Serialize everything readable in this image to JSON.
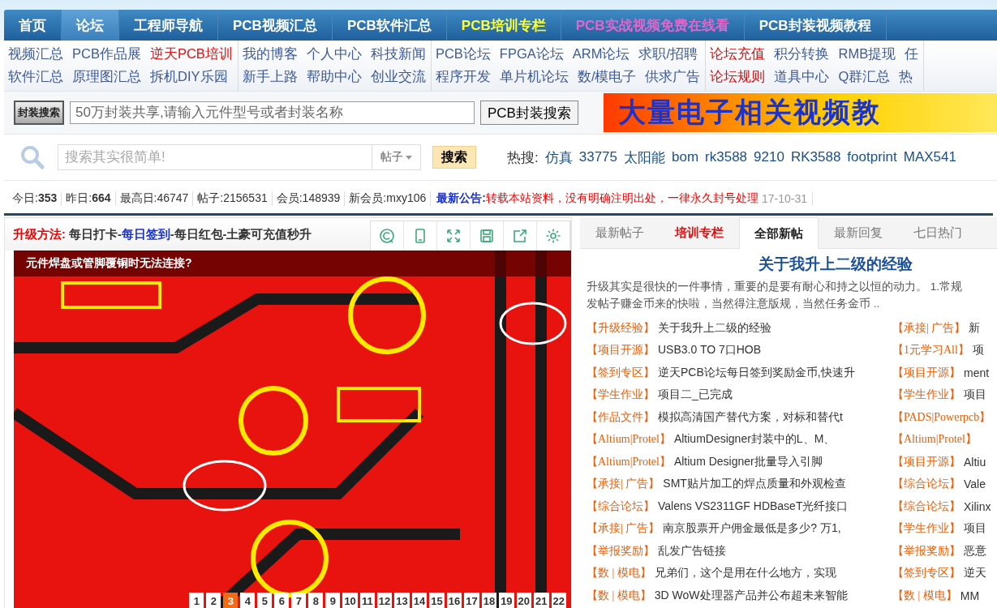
{
  "nav": {
    "items": [
      {
        "label": "首页",
        "selected": false,
        "kind": "normal"
      },
      {
        "label": "论坛",
        "selected": true,
        "kind": "normal"
      },
      {
        "label": "工程师导航",
        "selected": false,
        "kind": "normal"
      },
      {
        "label": "PCB视频汇总",
        "selected": false,
        "kind": "normal"
      },
      {
        "label": "PCB软件汇总",
        "selected": false,
        "kind": "normal"
      },
      {
        "label": "PCB培训专栏",
        "selected": false,
        "kind": "training"
      },
      {
        "label": "PCB实战视频免费在线看",
        "selected": false,
        "kind": "promo"
      },
      {
        "label": "PCB封装视频教程",
        "selected": false,
        "kind": "normal"
      }
    ]
  },
  "sub_links": [
    {
      "rows": [
        [
          {
            "label": "视频汇总",
            "color": "#3d5a99"
          },
          {
            "label": "PCB作品展",
            "color": "#3d5a99"
          },
          {
            "label": "逆天PCB培训",
            "color": "#dd1111"
          }
        ],
        [
          {
            "label": "软件汇总",
            "color": "#3d5a99"
          },
          {
            "label": "原理图汇总",
            "color": "#3d5a99"
          },
          {
            "label": "拆机DIY乐园",
            "color": "#3d5a99"
          }
        ]
      ]
    },
    {
      "rows": [
        [
          {
            "label": "我的博客",
            "color": "#3d5a99"
          },
          {
            "label": "个人中心",
            "color": "#3d5a99"
          },
          {
            "label": "科技新闻",
            "color": "#3d5a99"
          }
        ],
        [
          {
            "label": "新手上路",
            "color": "#3d5a99"
          },
          {
            "label": "帮助中心",
            "color": "#3d5a99"
          },
          {
            "label": "创业交流",
            "color": "#3d5a99"
          }
        ]
      ]
    },
    {
      "rows": [
        [
          {
            "label": "PCB论坛",
            "color": "#3d5a99"
          },
          {
            "label": "FPGA论坛",
            "color": "#3d5a99"
          },
          {
            "label": "ARM论坛",
            "color": "#3d5a99"
          },
          {
            "label": "求职/招聘",
            "color": "#3d5a99"
          }
        ],
        [
          {
            "label": "程序开发",
            "color": "#3d5a99"
          },
          {
            "label": "单片机论坛",
            "color": "#3d5a99"
          },
          {
            "label": "数/模电子",
            "color": "#3d5a99"
          },
          {
            "label": "供求广告",
            "color": "#3d5a99"
          }
        ]
      ]
    },
    {
      "rows": [
        [
          {
            "label": "论坛充值",
            "color": "#cc1111"
          },
          {
            "label": "积分转换",
            "color": "#3d5a99"
          },
          {
            "label": "RMB提现",
            "color": "#3d5a99"
          },
          {
            "label": "任",
            "color": "#3d5a99"
          }
        ],
        [
          {
            "label": "论坛规则",
            "color": "#cc1111"
          },
          {
            "label": "道具中心",
            "color": "#3d5a99"
          },
          {
            "label": "Q群汇总",
            "color": "#3d5a99"
          },
          {
            "label": "热",
            "color": "#3d5a99"
          }
        ]
      ]
    }
  ],
  "package_search": {
    "logo": "封装搜索",
    "placeholder": "50万封装共享,请输入元件型号或者封装名称",
    "button": "PCB封装搜索",
    "banner": "大量电子相关视频教"
  },
  "site_search": {
    "placeholder": "搜索其实很简单!",
    "scope": "帖子",
    "button": "搜索",
    "hot_label": "热搜:",
    "hot": [
      "仿真",
      "33775",
      "太阳能",
      "bom",
      "rk3588",
      "9210",
      "RK3588",
      "footprint",
      "MAX541"
    ]
  },
  "stats": [
    "今日:**353**",
    "昨日:**664**",
    "最高日:46747",
    "帖子:2156531",
    "会员:148939",
    "新会员:mxy106"
  ],
  "notice": {
    "label": "最新公告:",
    "text": "转载本站资料，没有明确注明出处，一律永久封号处理",
    "date": "17-10-31"
  },
  "slider": {
    "label": "升级方法:",
    "segments": [
      {
        "text": "每日打卡-",
        "kind": "plain"
      },
      {
        "text": "每日签到",
        "kind": "link"
      },
      {
        "text": "-每日红包-土豪可充值秒升",
        "kind": "plain"
      }
    ],
    "caption": "元件焊盘或管脚覆铜时无法连接?",
    "pages": [
      {
        "label": "1",
        "selected": false
      },
      {
        "label": "2",
        "selected": false
      },
      {
        "label": "3",
        "selected": true
      },
      {
        "label": "4",
        "selected": false
      },
      {
        "label": "5",
        "selected": false
      },
      {
        "label": "6",
        "selected": false
      },
      {
        "label": "7",
        "selected": false
      },
      {
        "label": "8",
        "selected": false
      },
      {
        "label": "9",
        "selected": false
      },
      {
        "label": "10",
        "selected": false
      },
      {
        "label": "11",
        "selected": false
      },
      {
        "label": "12",
        "selected": false
      },
      {
        "label": "13",
        "selected": false
      },
      {
        "label": "14",
        "selected": false
      },
      {
        "label": "15",
        "selected": false
      },
      {
        "label": "16",
        "selected": false
      },
      {
        "label": "17",
        "selected": false
      },
      {
        "label": "18",
        "selected": false
      },
      {
        "label": "19",
        "selected": false
      },
      {
        "label": "20",
        "selected": false
      },
      {
        "label": "21",
        "selected": false
      },
      {
        "label": "22",
        "selected": false
      }
    ]
  },
  "posts": {
    "tabs": [
      {
        "label": "最新帖子",
        "selected": false,
        "color": "#777777"
      },
      {
        "label": "培训专栏",
        "selected": false,
        "color": "#dd1111"
      },
      {
        "label": "全部新帖",
        "selected": true,
        "color": "#222222"
      },
      {
        "label": "最新回复",
        "selected": false,
        "color": "#777777"
      },
      {
        "label": "七日热门",
        "selected": false,
        "color": "#777777"
      }
    ],
    "headline": "关于我升上二级的经验",
    "summary": "升级其实是很快的一件事情，重要的是要有耐心和持之以恒的动力。 1.常规",
    "summary_2": "发帖子赚金币来的快啦，当然得注意版规，当然任务金币 ..",
    "left": [
      {
        "tag": "【升级经验】",
        "title": "关于我升上二级的经验"
      },
      {
        "tag": "【项目开源】",
        "title": "USB3.0 TO 7口HOB"
      },
      {
        "tag": "【签到专区】",
        "title": "逆天PCB论坛每日签到奖励金币,快速升"
      },
      {
        "tag": "【学生作业】",
        "title": "项目二_已完成"
      },
      {
        "tag": "【作品文件】",
        "title": "模拟高清国产替代方案，对标和替代t"
      },
      {
        "tag": "【Altium|Protel】",
        "title": "AltiumDesigner封装中的L、M、"
      },
      {
        "tag": "【Altium|Protel】",
        "title": "Altium Designer批量导入引脚"
      },
      {
        "tag": "【承接| 广告】",
        "title": "SMT贴片加工的焊点质量和外观检查"
      },
      {
        "tag": "【综合论坛】",
        "title": "Valens VS2311GF HDBaseT光纤接口"
      },
      {
        "tag": "【承接| 广告】",
        "title": "南京股票开户佣金最低是多少? 万1,"
      },
      {
        "tag": "【举报奖励】",
        "title": "乱发广告链接"
      },
      {
        "tag": "【数 | 模电】",
        "title": "兄弟们，这个是用在什么地方，实现"
      },
      {
        "tag": "【数 | 模电】",
        "title": "3D WoW处理器产品并公布超未来智能"
      }
    ],
    "right": [
      {
        "tag": "【承接| 广告】",
        "title": "新"
      },
      {
        "tag": "【1元学习All】",
        "title": "项"
      },
      {
        "tag": "【项目开源】",
        "title": "ment"
      },
      {
        "tag": "【学生作业】",
        "title": "项目"
      },
      {
        "tag": "【PADS|Powerpcb】"
      },
      {
        "tag": "【Altium|Protel】"
      },
      {
        "tag": "【项目开源】",
        "title": "Altiu"
      },
      {
        "tag": "【综合论坛】",
        "title": "Vale"
      },
      {
        "tag": "【综合论坛】",
        "title": "Xilinx"
      },
      {
        "tag": "【学生作业】",
        "title": "项目"
      },
      {
        "tag": "【举报奖励】",
        "title": "恶意"
      },
      {
        "tag": "【签到专区】",
        "title": "逆天"
      },
      {
        "tag": "【数 | 模电】",
        "title": "MM"
      }
    ]
  }
}
